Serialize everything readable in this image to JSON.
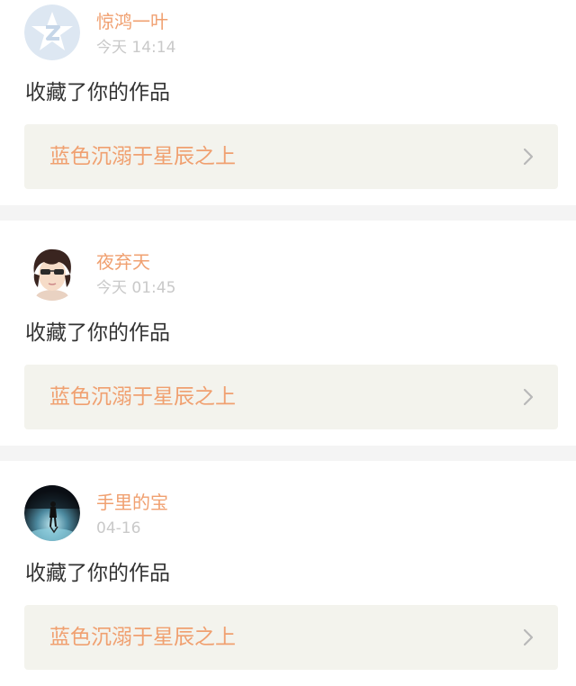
{
  "colors": {
    "accent": "#f0a070",
    "timestamp": "#c9c9c9",
    "text": "#333333",
    "card_bg": "#ffffff",
    "link_bg": "#f3f3ed",
    "separator": "#f4f4f4"
  },
  "notifications": [
    {
      "avatar_icon": "qzone-default-avatar-icon",
      "username": "惊鸿一叶",
      "time": "今天 14:14",
      "action": "收藏了你的作品",
      "work_title": "蓝色沉溺于星辰之上",
      "chevron_icon": "chevron-right-icon"
    },
    {
      "avatar_icon": "cartoon-person-avatar-icon",
      "username": "夜弃天",
      "time": "今天 01:45",
      "action": "收藏了你的作品",
      "work_title": "蓝色沉溺于星辰之上",
      "chevron_icon": "chevron-right-icon"
    },
    {
      "avatar_icon": "silhouette-photo-avatar-icon",
      "username": "手里的宝",
      "time": "04-16",
      "action": "收藏了你的作品",
      "work_title": "蓝色沉溺于星辰之上",
      "chevron_icon": "chevron-right-icon"
    }
  ]
}
